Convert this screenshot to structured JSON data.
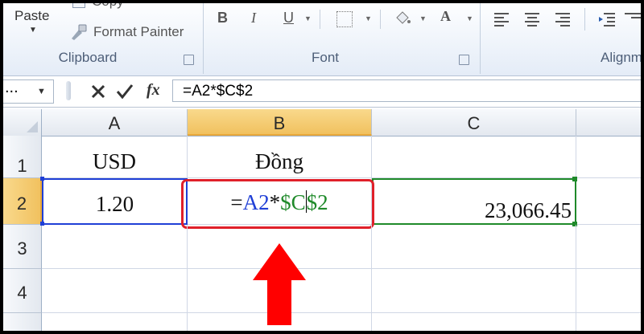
{
  "ribbon": {
    "clipboard": {
      "paste_label": "Paste",
      "copy_label": "Copy",
      "format_painter_label": "Format Painter",
      "group_title": "Clipboard"
    },
    "font": {
      "bold": "B",
      "italic": "I",
      "underline": "U",
      "font_color": "A",
      "group_title": "Font"
    },
    "alignment": {
      "group_title": "Alignm"
    }
  },
  "formula_bar": {
    "name_box_value": "...",
    "formula": "=A2*$C$2",
    "fx_label": "fx"
  },
  "grid": {
    "columns": [
      "A",
      "B",
      "C"
    ],
    "rows": [
      "1",
      "2",
      "3",
      "4"
    ],
    "cells": {
      "A1": "USD",
      "B1": "Đồng",
      "A2": "1.20",
      "C2": "23,066.45",
      "B2_parts": {
        "eq": "=",
        "ref1": "A2",
        "op": "*",
        "ref2a": "$C",
        "ref2b": "$2"
      }
    }
  },
  "colors": {
    "ref_blue": "#1f3fd6",
    "ref_green": "#1f8a2a",
    "highlight_red": "#e0202a",
    "arrow_red": "#ff0000"
  }
}
